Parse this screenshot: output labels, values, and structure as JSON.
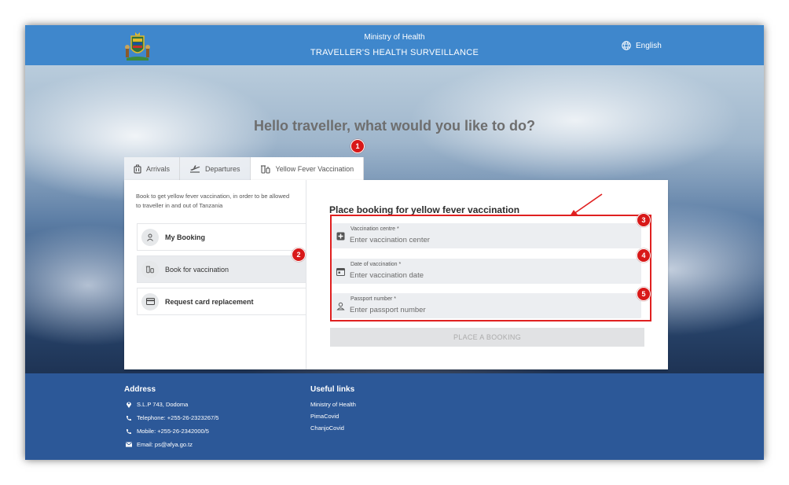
{
  "header": {
    "line1": "Ministry of Health",
    "line2": "TRAVELLER'S HEALTH SURVEILLANCE",
    "language": "English"
  },
  "hero": {
    "title": "Hello traveller, what would you like to do?"
  },
  "tabs": [
    {
      "label": "Arrivals",
      "icon": "luggage-icon"
    },
    {
      "label": "Departures",
      "icon": "airplane-takeoff-icon"
    },
    {
      "label": "Yellow Fever Vaccination",
      "icon": "vaccine-icon",
      "active": true
    }
  ],
  "sidebar": {
    "intro": "Book to get yellow fever vaccination, in order to be allowed to traveller in and out of Tanzania",
    "items": [
      {
        "label": "My Booking",
        "icon": "person-icon"
      },
      {
        "label": "Book for vaccination",
        "icon": "vaccine-icon",
        "selected": true
      },
      {
        "label": "Request card replacement",
        "icon": "card-icon"
      }
    ]
  },
  "form": {
    "title": "Place booking for yellow fever vaccination",
    "fields": [
      {
        "label": "Vaccination centre *",
        "placeholder": "Enter vaccination center",
        "icon": "plus-box-icon"
      },
      {
        "label": "Date of vaccination *",
        "placeholder": "Enter vaccination date",
        "icon": "calendar-icon"
      },
      {
        "label": "Passport number *",
        "placeholder": "Enter passport number",
        "icon": "person-icon"
      }
    ],
    "submit_label": "PLACE A BOOKING"
  },
  "annotations": {
    "badges": [
      "1",
      "2",
      "3",
      "4",
      "5"
    ],
    "highlight_color": "#e02020"
  },
  "footer": {
    "address_heading": "Address",
    "address_lines": [
      {
        "icon": "location-pin-icon",
        "text": "S.L.P 743, Dodoma"
      },
      {
        "icon": "phone-icon",
        "text": "Telephone: +255-26-2323267/5"
      },
      {
        "icon": "mobile-phone-icon",
        "text": "Mobile: +255-26-2342000/5"
      },
      {
        "icon": "mail-icon",
        "text": "Email: ps@afya.go.tz"
      }
    ],
    "links_heading": "Useful links",
    "links": [
      "Ministry of Health",
      "PimaCovid",
      "ChanjoCovid"
    ]
  },
  "colors": {
    "header": "#3f87cc",
    "footer": "#2c5898",
    "badge": "#d81818"
  }
}
